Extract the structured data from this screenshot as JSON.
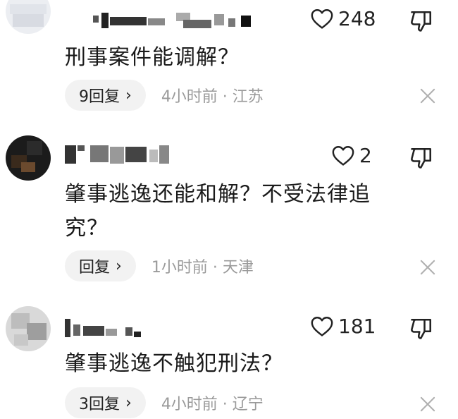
{
  "comments": [
    {
      "likes": "248",
      "text": "刑事案件能调解？",
      "reply_label": "9回复",
      "time": "4小时前",
      "location": "江苏"
    },
    {
      "likes": "2",
      "text": "肇事逃逸还能和解？不受法律追究？",
      "reply_label": "回复",
      "time": "1小时前",
      "location": "天津"
    },
    {
      "likes": "181",
      "text": "肇事逃逸不触犯刑法？",
      "reply_label": "3回复",
      "time": "4小时前",
      "location": "辽宁"
    }
  ],
  "separator": " · ",
  "icons": {
    "like": "heart-outline-icon",
    "dislike": "thumbs-down-outline-icon",
    "close": "close-icon",
    "chevron": "chevron-right-icon"
  },
  "colors": {
    "text": "#1a1a1a",
    "meta": "#9a9a9a",
    "reply_bg": "#f2f2f2"
  }
}
